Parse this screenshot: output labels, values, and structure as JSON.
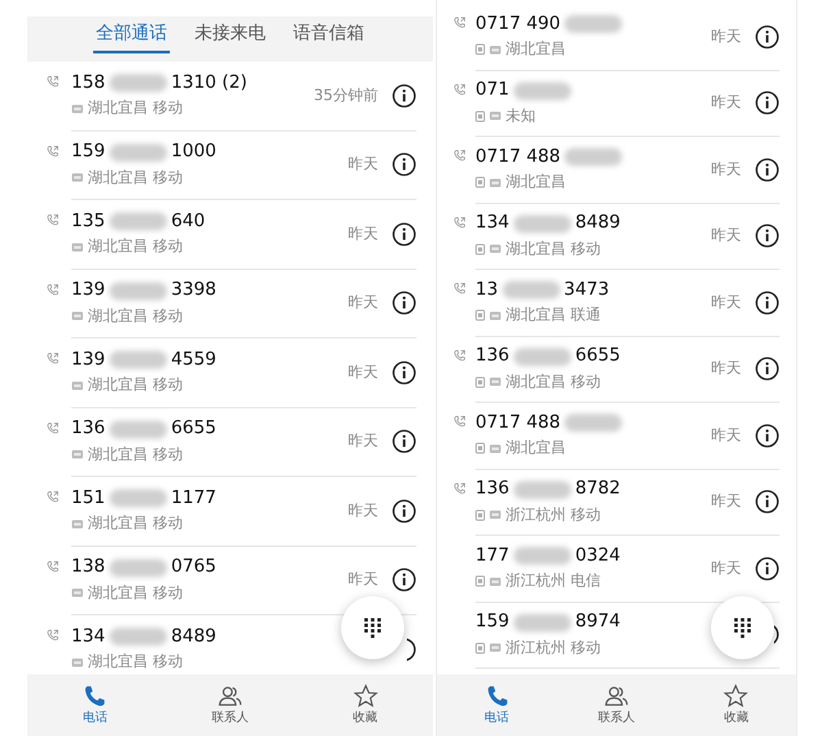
{
  "left_screen": {
    "tabs": [
      {
        "label": "全部通话",
        "selected": true
      },
      {
        "label": "未接来电",
        "selected": false
      },
      {
        "label": "语音信箱",
        "selected": false
      }
    ],
    "calls": [
      {
        "number_start": "158",
        "number_end": "1310 (2)",
        "location": "湖北宜昌 移动",
        "time": "35分钟前",
        "call_icon": true,
        "hd_badge": false
      },
      {
        "number_start": "159",
        "number_end": "1000",
        "location": "湖北宜昌 移动",
        "time": "昨天",
        "call_icon": true,
        "hd_badge": false
      },
      {
        "number_start": "135",
        "number_end": "640",
        "location": "湖北宜昌 移动",
        "time": "昨天",
        "call_icon": true,
        "hd_badge": false
      },
      {
        "number_start": "139",
        "number_end": "3398",
        "location": "湖北宜昌 移动",
        "time": "昨天",
        "call_icon": true,
        "hd_badge": false
      },
      {
        "number_start": "139",
        "number_end": "4559",
        "location": "湖北宜昌 移动",
        "time": "昨天",
        "call_icon": true,
        "hd_badge": false
      },
      {
        "number_start": "136",
        "number_end": "6655",
        "location": "湖北宜昌 移动",
        "time": "昨天",
        "call_icon": true,
        "hd_badge": false
      },
      {
        "number_start": "151",
        "number_end": "1177",
        "location": "湖北宜昌 移动",
        "time": "昨天",
        "call_icon": true,
        "hd_badge": false
      },
      {
        "number_start": "138",
        "number_end": "0765",
        "location": "湖北宜昌 移动",
        "time": "昨天",
        "call_icon": true,
        "hd_badge": false
      },
      {
        "number_start": "134",
        "number_end": "8489",
        "location": "湖北宜昌 移动",
        "call_icon": true,
        "hd_badge": false
      }
    ],
    "nav": [
      {
        "label": "电话",
        "selected": true
      },
      {
        "label": "联系人",
        "selected": false
      },
      {
        "label": "收藏",
        "selected": false
      }
    ]
  },
  "right_screen": {
    "calls": [
      {
        "number_start": "0717 490",
        "location": "湖北宜昌",
        "time": "昨天",
        "call_icon": true,
        "hd_badge": true
      },
      {
        "number_start": "071",
        "location": "未知",
        "time": "昨天",
        "call_icon": true,
        "hd_badge": true
      },
      {
        "number_start": "0717 488",
        "location": "湖北宜昌",
        "time": "昨天",
        "call_icon": true,
        "hd_badge": true
      },
      {
        "number_start": "134",
        "number_end": "8489",
        "location": "湖北宜昌 移动",
        "time": "昨天",
        "call_icon": true,
        "hd_badge": true
      },
      {
        "number_start": "13",
        "number_end": "3473",
        "location": "湖北宜昌 联通",
        "time": "昨天",
        "call_icon": true,
        "hd_badge": true
      },
      {
        "number_start": "136",
        "number_end": "6655",
        "location": "湖北宜昌 移动",
        "time": "昨天",
        "call_icon": true,
        "hd_badge": true
      },
      {
        "number_start": "0717 488",
        "location": "湖北宜昌",
        "time": "昨天",
        "call_icon": true,
        "hd_badge": true
      },
      {
        "number_start": "136",
        "number_end": "8782",
        "location": "浙江杭州 移动",
        "time": "昨天",
        "call_icon": true,
        "hd_badge": true
      },
      {
        "number_start": "177",
        "number_end": "0324",
        "location": "浙江杭州 电信",
        "time": "昨天",
        "call_icon": false,
        "hd_badge": true
      },
      {
        "number_start": "159",
        "number_end": "8974",
        "location": "浙江杭州 移动",
        "call_icon": false,
        "hd_badge": true
      }
    ],
    "nav": [
      {
        "label": "电话",
        "selected": true
      },
      {
        "label": "联系人",
        "selected": false
      },
      {
        "label": "收藏",
        "selected": false
      }
    ]
  }
}
